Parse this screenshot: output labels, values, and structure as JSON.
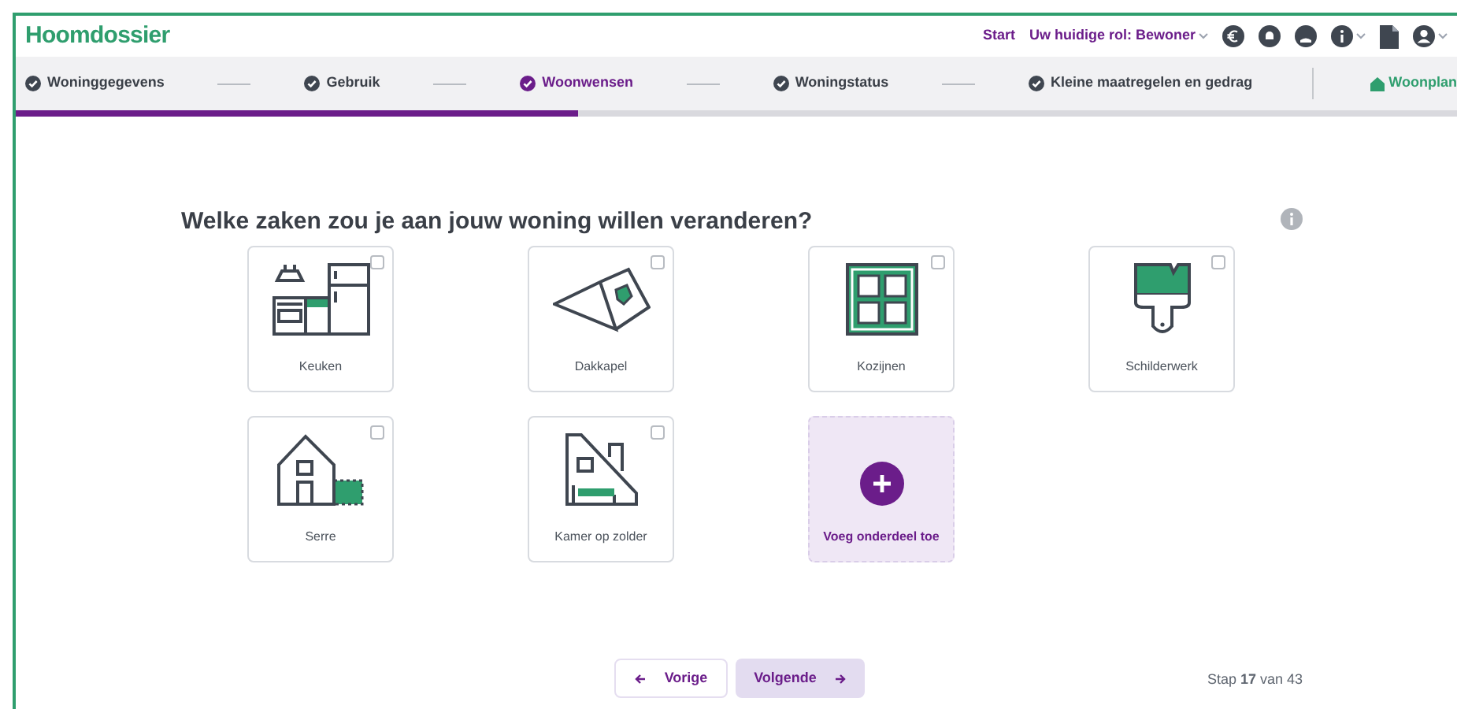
{
  "header": {
    "logo": "Hoomdossier",
    "start": "Start",
    "role": "Uw huidige rol: Bewoner"
  },
  "steps": [
    {
      "kind": "step",
      "label": "Woninggegevens",
      "selected": false
    },
    {
      "kind": "step",
      "label": "Gebruik",
      "selected": false
    },
    {
      "kind": "step",
      "label": "Woonwensen",
      "selected": true
    },
    {
      "kind": "step",
      "label": "Woningstatus",
      "selected": false
    },
    {
      "kind": "step",
      "label": "Kleine maatregelen en gedrag",
      "selected": false
    },
    {
      "kind": "plan",
      "label": "Woonplan",
      "selected": false
    }
  ],
  "progress": {
    "level": 0.39
  },
  "question": "Welke zaken zou je aan jouw woning willen veranderen?",
  "options": [
    {
      "kind": "option",
      "label": "Keuken",
      "checked": false
    },
    {
      "kind": "option",
      "label": "Dakkapel",
      "checked": false
    },
    {
      "kind": "option",
      "label": "Kozijnen",
      "checked": false
    },
    {
      "kind": "option",
      "label": "Schilderwerk",
      "checked": false
    },
    {
      "kind": "option",
      "label": "Serre",
      "checked": false
    },
    {
      "kind": "option",
      "label": "Kamer op zolder",
      "checked": false
    },
    {
      "kind": "add",
      "label": "Voeg onderdeel toe"
    }
  ],
  "nav": {
    "previous": "Vorige",
    "next": "Volgende"
  },
  "step_counter": "Stap **17** van 43"
}
